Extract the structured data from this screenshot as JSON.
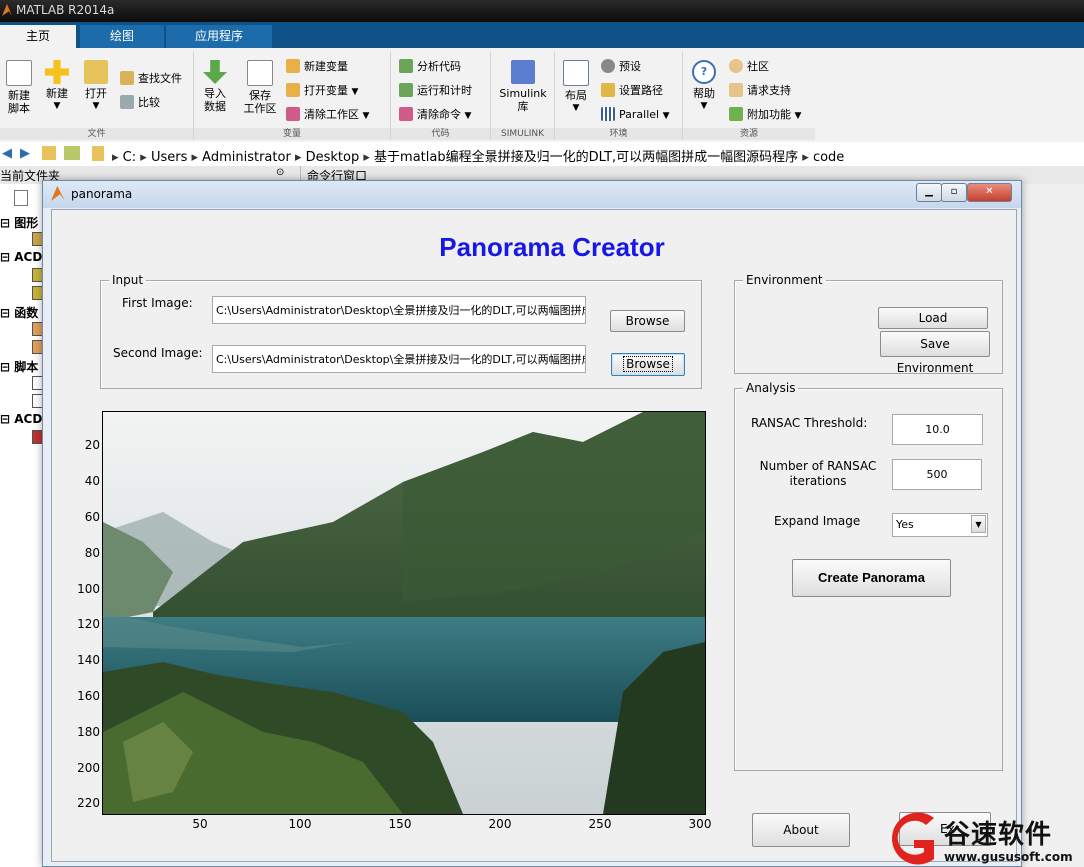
{
  "matlab": {
    "title": "MATLAB R2014a",
    "tabs": [
      "主页",
      "绘图",
      "应用程序"
    ],
    "ribbon": {
      "file": {
        "label": "文件",
        "new_script": "新建\n脚本",
        "new": "新建",
        "open": "打开",
        "find_files": "查找文件",
        "compare": "比较"
      },
      "variable": {
        "label": "变量",
        "import": "导入\n数据",
        "save": "保存\n工作区",
        "new_var": "新建变量",
        "open_var": "打开变量",
        "clear_ws": "清除工作区"
      },
      "code": {
        "label": "代码",
        "analyze": "分析代码",
        "run_time": "运行和计时",
        "clear_cmd": "清除命令"
      },
      "simulink": {
        "label": "SIMULINK",
        "lib": "Simulink\n库"
      },
      "env": {
        "label": "环境",
        "layout": "布局",
        "prefs": "预设",
        "set_path": "设置路径",
        "parallel": "Parallel"
      },
      "resources": {
        "label": "资源",
        "help": "帮助",
        "community": "社区",
        "request_support": "请求支持",
        "addons": "附加功能"
      }
    },
    "address": [
      "C:",
      "Users",
      "Administrator",
      "Desktop",
      "基于matlab编程全景拼接及归一化的DLT,可以两幅图拼成一幅图源码程序",
      "code"
    ],
    "current_folder": "当前文件夹",
    "command_window": "命令行窗口",
    "left_groups": [
      "图形",
      "ACDS",
      "函数",
      "脚本",
      "ACDS"
    ]
  },
  "figure": {
    "window_title": "panorama",
    "app_title": "Panorama Creator",
    "input": {
      "title": "Input",
      "first_label": "First Image:",
      "first_path": "C:\\Users\\Administrator\\Desktop\\全景拼接及归一化的DLT,可以两幅图拼成一幅",
      "second_label": "Second Image:",
      "second_path": "C:\\Users\\Administrator\\Desktop\\全景拼接及归一化的DLT,可以两幅图拼成一幅",
      "browse1": "Browse",
      "browse2": "Browse"
    },
    "environment": {
      "title": "Environment",
      "load": "Load Environment",
      "save": "Save Environment"
    },
    "analysis": {
      "title": "Analysis",
      "threshold_label": "RANSAC Threshold:",
      "threshold_value": "10.0",
      "iterations_label": "Number of RANSAC\niterations",
      "iterations_value": "500",
      "expand_label": "Expand Image",
      "expand_value": "Yes",
      "create": "Create Panorama"
    },
    "about": "About",
    "exit_partial": "Ex",
    "axes": {
      "yticks": [
        "20",
        "40",
        "60",
        "80",
        "100",
        "120",
        "140",
        "160",
        "180",
        "200",
        "220"
      ],
      "xticks": [
        "50",
        "100",
        "150",
        "200",
        "250",
        "300"
      ]
    }
  },
  "watermark": {
    "brand": "谷速软件",
    "url": "www.gususoft.com"
  }
}
